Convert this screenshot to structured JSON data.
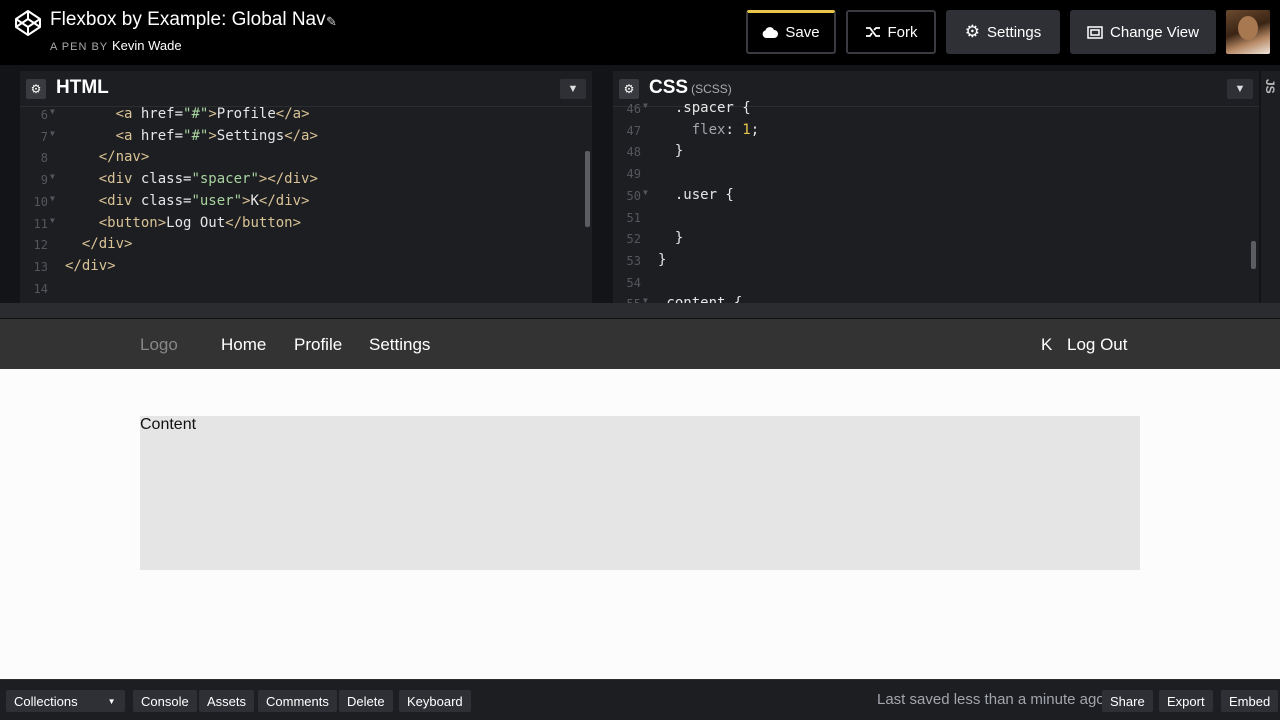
{
  "header": {
    "title": "Flexbox by Example: Global Nav",
    "byline_prefix": "A PEN BY",
    "author": "Kevin Wade",
    "buttons": {
      "save": "Save",
      "fork": "Fork",
      "settings": "Settings",
      "change_view": "Change View"
    },
    "accent": "#e8c64b"
  },
  "html_editor": {
    "title": "HTML",
    "lines": [
      {
        "n": "6",
        "fold": true,
        "indent": "      ",
        "parts": [
          [
            "tag",
            "<a "
          ],
          [
            "attr",
            "href="
          ],
          [
            "str",
            "\"#\""
          ],
          [
            "tag",
            ">"
          ],
          [
            "attr",
            "Profile"
          ],
          [
            "tag",
            "</a>"
          ]
        ]
      },
      {
        "n": "7",
        "fold": true,
        "indent": "      ",
        "parts": [
          [
            "tag",
            "<a "
          ],
          [
            "attr",
            "href="
          ],
          [
            "str",
            "\"#\""
          ],
          [
            "tag",
            ">"
          ],
          [
            "attr",
            "Settings"
          ],
          [
            "tag",
            "</a>"
          ]
        ]
      },
      {
        "n": "8",
        "fold": false,
        "indent": "    ",
        "parts": [
          [
            "tag",
            "</nav>"
          ]
        ]
      },
      {
        "n": "9",
        "fold": true,
        "indent": "    ",
        "parts": [
          [
            "tag",
            "<div "
          ],
          [
            "attr",
            "class="
          ],
          [
            "str",
            "\"spacer\""
          ],
          [
            "tag",
            "></div>"
          ]
        ]
      },
      {
        "n": "10",
        "fold": true,
        "indent": "    ",
        "parts": [
          [
            "tag",
            "<div "
          ],
          [
            "attr",
            "class="
          ],
          [
            "str",
            "\"user\""
          ],
          [
            "tag",
            ">"
          ],
          [
            "attr",
            "K"
          ],
          [
            "tag",
            "</div>"
          ]
        ]
      },
      {
        "n": "11",
        "fold": true,
        "indent": "    ",
        "parts": [
          [
            "tag",
            "<button>"
          ],
          [
            "attr",
            "Log Out"
          ],
          [
            "tag",
            "</button>"
          ]
        ]
      },
      {
        "n": "12",
        "fold": false,
        "indent": "  ",
        "parts": [
          [
            "tag",
            "</div>"
          ]
        ]
      },
      {
        "n": "13",
        "fold": false,
        "indent": "",
        "parts": [
          [
            "tag",
            "</div>"
          ]
        ]
      },
      {
        "n": "14",
        "fold": false,
        "indent": "",
        "parts": []
      }
    ]
  },
  "css_editor": {
    "title": "CSS",
    "subtitle": "(SCSS)",
    "lines": [
      {
        "n": "46",
        "fold": true,
        "indent": "  ",
        "parts": [
          [
            "attr",
            ".spacer {"
          ]
        ]
      },
      {
        "n": "47",
        "fold": false,
        "indent": "    ",
        "parts": [
          [
            "prop",
            "flex"
          ],
          [
            "attr",
            ": "
          ],
          [
            "num",
            "1"
          ],
          [
            "attr",
            ";"
          ]
        ]
      },
      {
        "n": "48",
        "fold": false,
        "indent": "  ",
        "parts": [
          [
            "attr",
            "}"
          ]
        ]
      },
      {
        "n": "49",
        "fold": false,
        "indent": "",
        "parts": []
      },
      {
        "n": "50",
        "fold": true,
        "indent": "  ",
        "parts": [
          [
            "attr",
            ".user {"
          ]
        ]
      },
      {
        "n": "51",
        "fold": false,
        "indent": "",
        "parts": []
      },
      {
        "n": "52",
        "fold": false,
        "indent": "  ",
        "parts": [
          [
            "attr",
            "}"
          ]
        ]
      },
      {
        "n": "53",
        "fold": false,
        "indent": "",
        "parts": [
          [
            "attr",
            "}"
          ]
        ]
      },
      {
        "n": "54",
        "fold": false,
        "indent": "",
        "parts": []
      },
      {
        "n": "55",
        "fold": true,
        "indent": "",
        "parts": [
          [
            "attr",
            ".content {"
          ]
        ]
      }
    ]
  },
  "js_tab": {
    "label": "JS"
  },
  "preview": {
    "logo": "Logo",
    "links": [
      "Home",
      "Profile",
      "Settings"
    ],
    "user": "K",
    "logout": "Log Out",
    "content": "Content"
  },
  "footer": {
    "collections": "Collections",
    "buttons": [
      "Console",
      "Assets",
      "Comments",
      "Delete",
      "Keyboard"
    ],
    "status": "Last saved less than a minute ago",
    "right_buttons": [
      "Share",
      "Export",
      "Embed"
    ]
  }
}
